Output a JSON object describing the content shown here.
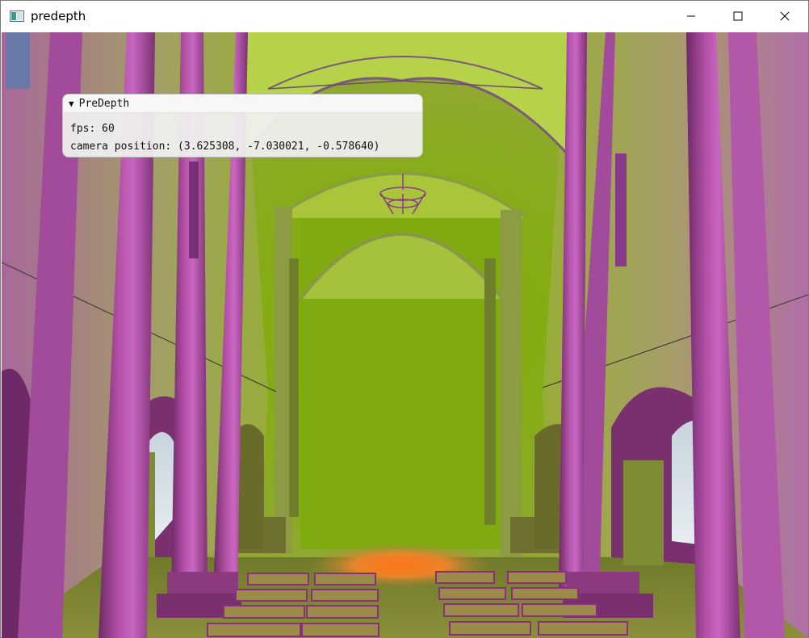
{
  "window": {
    "title": "predepth",
    "icon": "app-window-icon",
    "controls": {
      "minimize": "minimize-icon",
      "maximize": "maximize-icon",
      "close": "close-icon"
    }
  },
  "scene": {
    "description_icon": "3d-render-viewport",
    "colors": {
      "wall_green": "#8aab24",
      "pillar_magenta": "#9a3b8c",
      "floor_glow": "#ff7a1c"
    }
  },
  "panel": {
    "title": "PreDepth",
    "fps_line": "fps: 60",
    "camera_line": "camera position: (3.625308, -7.030021, -0.578640)"
  }
}
